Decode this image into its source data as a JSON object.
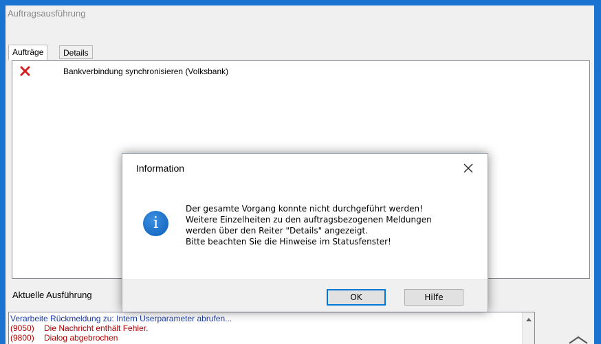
{
  "window": {
    "title": "Auftragsausführung"
  },
  "tabs": [
    {
      "label": "Aufträge"
    },
    {
      "label": "Details"
    }
  ],
  "jobs": [
    {
      "status_icon": "red-x-icon",
      "text": "Bankverbindung synchronisieren (Volksbank)"
    }
  ],
  "current_execution": {
    "label": "Aktuelle Ausführung",
    "log": [
      {
        "code": "",
        "text": "Verarbeite Rückmeldung zu: Intern Userparameter abrufen..."
      },
      {
        "code": "(9050)",
        "text": "Die Nachricht enthält Fehler."
      },
      {
        "code": "(9800)",
        "text": "Dialog abgebrochen"
      }
    ]
  },
  "dialog": {
    "title": "Information",
    "icon": "info-icon",
    "message_lines": [
      "Der gesamte Vorgang konnte nicht durchgeführt werden!",
      "Weitere Einzelheiten zu den auftragsbezogenen Meldungen",
      "werden über den Reiter \"Details\" angezeigt.",
      "Bitte beachten Sie die Hinweise im Statusfenster!"
    ],
    "ok_label": "OK",
    "help_label": "Hilfe"
  },
  "colors": {
    "background_blue": "#1a73d1",
    "error_red": "#b00000",
    "log_blue": "#1a3aa8",
    "focus_blue": "#0078d7"
  }
}
